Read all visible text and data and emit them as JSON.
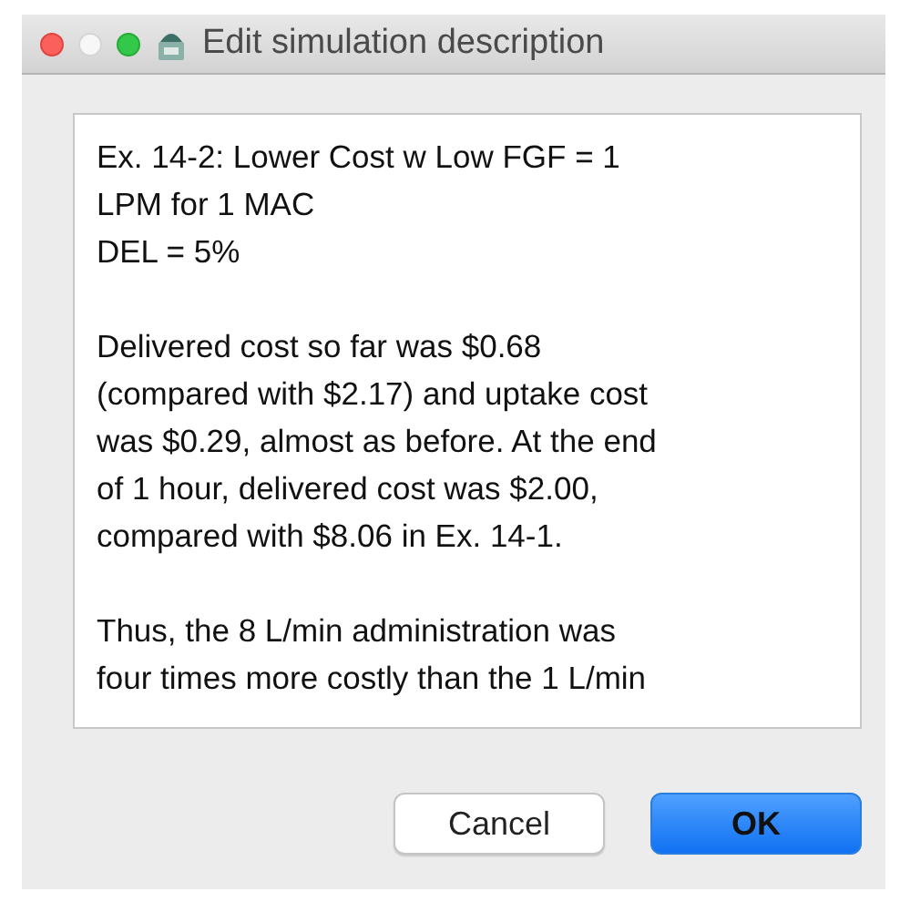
{
  "window": {
    "title": "Edit simulation description",
    "controls": [
      {
        "kind": "close",
        "disabled": false
      },
      {
        "kind": "minimize",
        "disabled": true
      },
      {
        "kind": "zoom",
        "disabled": false
      }
    ]
  },
  "description": {
    "paragraphs": [
      [
        "Ex. 14-2: Lower Cost w Low FGF = 1",
        "LPM for 1 MAC",
        "DEL = 5%"
      ],
      [
        "Delivered cost so far was $0.68",
        "(compared with $2.17) and uptake cost",
        "was $0.29, almost as before. At the end",
        "of 1 hour, delivered cost was $2.00,",
        "compared with $8.06 in Ex. 14-1."
      ],
      [
        "Thus, the 8 L/min administration was",
        "four times more costly than the 1 L/min"
      ]
    ]
  },
  "buttons": [
    {
      "label": "Cancel",
      "default": false
    },
    {
      "label": "OK",
      "default": true
    }
  ]
}
